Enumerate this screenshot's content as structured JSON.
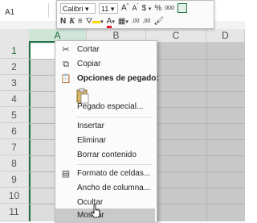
{
  "formula_bar": {
    "name_box": "A1"
  },
  "columns": [
    "A",
    "B",
    "C",
    "D"
  ],
  "rows": [
    "1",
    "2",
    "3",
    "4",
    "5",
    "6",
    "7",
    "8",
    "9",
    "10",
    "11"
  ],
  "mini_toolbar": {
    "font": "Calibri",
    "size": "11",
    "grow_font": "A",
    "shrink_font": "A",
    "currency": "$",
    "percent": "%",
    "thousands": "000",
    "bold": "N",
    "italic": "K",
    "font_color_letter": "A",
    "decrease_decimals": ",00",
    "increase_decimals": ",00",
    "fill_color": "#ffd400",
    "font_color": "#e81123"
  },
  "context_menu": {
    "cut": "Cortar",
    "copy": "Copiar",
    "paste_options": "Opciones de pegado:",
    "paste_special": "Pegado especial...",
    "insert": "Insertar",
    "delete": "Eliminar",
    "clear": "Borrar contenido",
    "format_cells": "Formato de celdas...",
    "column_width": "Ancho de columna...",
    "hide": "Ocultar",
    "unhide": "Mostrar"
  },
  "theme": {
    "accent": "#217346",
    "menu_hover": "#c9c9c9"
  }
}
